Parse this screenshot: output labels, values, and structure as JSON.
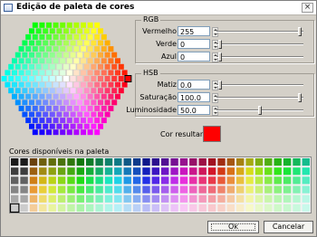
{
  "window": {
    "title": "Edição de paleta de cores",
    "close_glyph": "×",
    "icon": "palette-icon"
  },
  "rgb": {
    "title": "RGB",
    "red": {
      "label": "Vermelho",
      "value": "255",
      "level": 1.0
    },
    "green": {
      "label": "Verde",
      "value": "0",
      "level": 0.0
    },
    "blue": {
      "label": "Azul",
      "value": "0",
      "level": 0.0
    }
  },
  "hsb": {
    "title": "HSB",
    "hue": {
      "label": "Matiz",
      "value": "0.0",
      "level": 0.0
    },
    "saturation": {
      "label": "Saturação",
      "value": "100.0",
      "level": 1.0
    },
    "brightness": {
      "label": "Luminosidade",
      "value": "50.0",
      "level": 0.5
    }
  },
  "result": {
    "label": "Cor resultante",
    "color": "#ff0000"
  },
  "palette": {
    "label": "Cores disponíveis na paleta",
    "columns": 32,
    "rows": 6,
    "selected": {
      "row": 5,
      "col": 0
    }
  },
  "buttons": {
    "ok": "Ok",
    "cancel": "Cancelar"
  },
  "colors": {
    "frame": "#d4d0c8",
    "selection_outline": "#000000"
  }
}
